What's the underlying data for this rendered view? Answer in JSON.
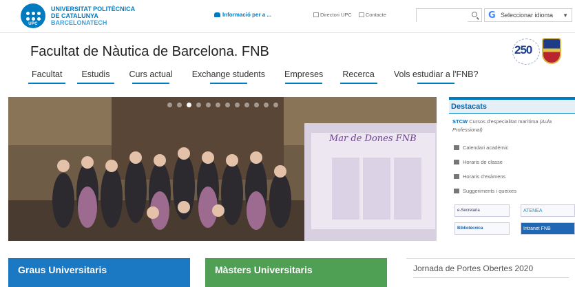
{
  "brand": {
    "line1": "UNIVERSITAT POLITÈCNICA",
    "line2": "DE CATALUNYA",
    "line3": "BARCELONATECH",
    "badge": "UPC"
  },
  "utility": {
    "info_label": "Informació per a ...",
    "directory_label": "Directori UPC",
    "contact_label": "Contacte",
    "search_placeholder": "",
    "language_label": "Seleccionar idioma",
    "language_arrow": "▼"
  },
  "header": {
    "title": "Facultat de Nàutica de Barcelona.  FNB",
    "anniversary_number": "250"
  },
  "nav": {
    "items": [
      "Facultat",
      "Estudis",
      "Curs actual",
      "Exchange students",
      "Empreses",
      "Recerca",
      "Vols estudiar a l'FNB?"
    ]
  },
  "hero": {
    "poster_title": "Mar de Dones FNB",
    "slides": 12,
    "active_slide": 3
  },
  "sidebar": {
    "title": "Destacats",
    "stcw_code": "STCW",
    "stcw_text": "Cursos d'especialitat marítima",
    "stcw_aula": "(Aula Professional)",
    "items": [
      "Calendari acadèmic",
      "Horaris de classe",
      "Horaris d'exàmens",
      "Suggeriments i queixes"
    ],
    "banners": [
      "e-Secretaria",
      "ATENEA",
      "Bibliotècnica",
      "Intranet FNB"
    ]
  },
  "boxes": {
    "graus": "Graus Universitaris",
    "masters": "Màsters Universitaris",
    "jornada": "Jornada de Portes Obertes 2020"
  },
  "colors": {
    "accent": "#007bc0",
    "graus": "#1b79c4",
    "masters": "#4f9f55"
  }
}
